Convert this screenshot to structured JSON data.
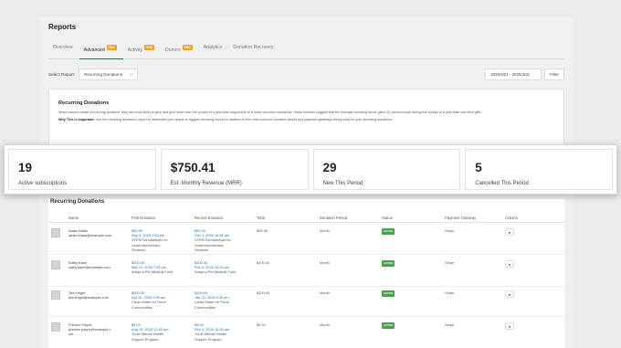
{
  "page": {
    "title": "Reports"
  },
  "tabs": [
    {
      "label": "Overview",
      "pro": ""
    },
    {
      "label": "Advanced",
      "pro": "PRO"
    },
    {
      "label": "Activity",
      "pro": "PRO"
    },
    {
      "label": "Donors",
      "pro": "PRO"
    },
    {
      "label": "Analytics",
      "pro": ""
    },
    {
      "label": "Donation Recovery",
      "pro": ""
    }
  ],
  "filter": {
    "select_label": "Select Report:",
    "selected": "Recurring Donations",
    "date_range": "2025/3/01 - 2025/4/31",
    "button": "Filter"
  },
  "info": {
    "title": "Recurring Donations",
    "p1": "When donors create a recurring donation, they are more likely to give and give more over the course of a year than supporters of a make one-time donations. Some sources suggest that the average recurring donor gives 42 percent more during the course of a year than one-time gifts.",
    "p2_bold": "Why This is Important:",
    "p2": "Use the recurring donations report to determine your oldest or biggest recurring donors in addition to the most common donation period and payment gateways being used for your recurring donations."
  },
  "stats": [
    {
      "value": "19",
      "label": "Active subscriptions"
    },
    {
      "value": "$750.41",
      "label": "Est. Monthly Revenue (MRR)"
    },
    {
      "value": "29",
      "label": "New This Period"
    },
    {
      "value": "5",
      "label": "Cancelled This Period"
    }
  ],
  "table": {
    "title": "Recurring Donations",
    "headers": {
      "name": "Name",
      "first": "First Donation",
      "recent": "Recent Donation",
      "total": "Total",
      "period": "Donation Period",
      "status": "Status",
      "gateway": "Payment Gateway",
      "actions": "Actions"
    },
    "rows": [
      {
        "name": "Adam Blake",
        "email": "adam.blake@example.com",
        "first_amt": "$50.00",
        "first_date": "Sep 3, 2025 2:55 pm",
        "first_l1": "STEM Scholarships for",
        "first_l2": "Underrepresented",
        "first_l3": "Students",
        "recent_amt": "$50.00",
        "recent_date": "Feb 4, 2026 10:28 am",
        "recent_l1": "STEM Scholarships for",
        "recent_l2": "Underrepresented",
        "recent_l3": "Students",
        "total": "$50.56",
        "period": "Month",
        "status": "ACTIVE",
        "gateway": "Stripe"
      },
      {
        "name": "Kathy Kane",
        "email": "kathy.kane@example.com",
        "first_amt": "$200.00",
        "first_date": "Mar 12, 2025 7:05 pm",
        "first_l1": "Adopt-a-Pet Medical Fund",
        "first_l2": "",
        "first_l3": "",
        "recent_amt": "$200.00",
        "recent_date": "Feb 4, 2026 10:28 am",
        "recent_l1": "Adopt-a-Pet Medical Fund",
        "recent_l2": "",
        "recent_l3": "",
        "total": "$200.00",
        "period": "Month",
        "status": "ACTIVE",
        "gateway": "Stripe"
      },
      {
        "name": "Ted Knight",
        "email": "ted.knight@example.com",
        "first_amt": "$200.00",
        "first_date": "Apr 30, 2025 9:30 am",
        "first_l1": "Clean Water for Rural",
        "first_l2": "Communities",
        "first_l3": "",
        "recent_amt": "$200.00",
        "recent_date": "Jan 23, 2026 9:25 pm",
        "recent_l1": "Clean Water for Rural",
        "recent_l2": "Communities",
        "recent_l3": "",
        "total": "$200.00",
        "period": "Month",
        "status": "ACTIVE",
        "gateway": "Stripe"
      },
      {
        "name": "Preston Payne",
        "email": "preston.payne@example.c",
        "email2": "om",
        "first_amt": "$5.00",
        "first_date": "Aug 13, 2025 12:45 am",
        "first_l1": "Youth Mental Health",
        "first_l2": "Support Program",
        "first_l3": "",
        "recent_amt": "$5.00",
        "recent_date": "Feb 4, 2026 10:28 am",
        "recent_l1": "Youth Mental Health",
        "recent_l2": "Support Program",
        "recent_l3": "",
        "total": "$5.30",
        "period": "Month",
        "status": "ACTIVE",
        "gateway": "Stripe"
      }
    ]
  }
}
